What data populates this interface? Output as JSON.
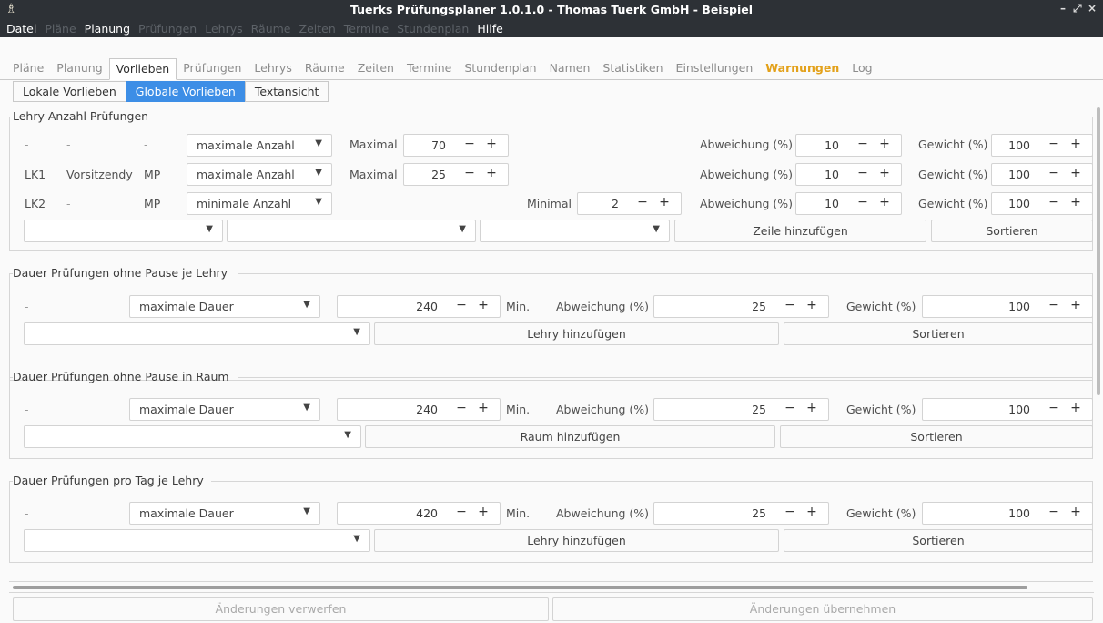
{
  "window": {
    "title": "Tuerks Prüfungsplaner 1.0.1.0 - Thomas Tuerk GmbH - Beispiel",
    "controls": [
      "–",
      "⤢",
      "×"
    ]
  },
  "menu": [
    {
      "label": "Datei",
      "enabled": true
    },
    {
      "label": "Pläne",
      "enabled": false
    },
    {
      "label": "Planung",
      "enabled": true
    },
    {
      "label": "Prüfungen",
      "enabled": false
    },
    {
      "label": "Lehrys",
      "enabled": false
    },
    {
      "label": "Räume",
      "enabled": false
    },
    {
      "label": "Zeiten",
      "enabled": false
    },
    {
      "label": "Termine",
      "enabled": false
    },
    {
      "label": "Stundenplan",
      "enabled": false
    },
    {
      "label": "Hilfe",
      "enabled": true
    }
  ],
  "tabs": [
    "Pläne",
    "Planung",
    "Vorlieben",
    "Prüfungen",
    "Lehrys",
    "Räume",
    "Zeiten",
    "Termine",
    "Stundenplan",
    "Namen",
    "Statistiken",
    "Einstellungen",
    "Warnungen",
    "Log"
  ],
  "active_tab": "Vorlieben",
  "subtabs": [
    "Lokale Vorlieben",
    "Globale Vorlieben",
    "Textansicht"
  ],
  "active_subtab": "Globale Vorlieben",
  "sections": {
    "lehry_anzahl": {
      "title": "Lehry Anzahl Prüfungen",
      "rows": [
        {
          "c1": "-",
          "c2": "-",
          "c3": "-",
          "mode": "maximale Anzahl",
          "limit_label": "Maximal",
          "limit": "70",
          "dev_label": "Abweichung (%)",
          "dev": "10",
          "weight_label": "Gewicht (%)",
          "weight": "100"
        },
        {
          "c1": "LK1",
          "c2": "Vorsitzendy",
          "c3": "MP",
          "mode": "maximale Anzahl",
          "limit_label": "Maximal",
          "limit": "25",
          "dev_label": "Abweichung (%)",
          "dev": "10",
          "weight_label": "Gewicht (%)",
          "weight": "100"
        },
        {
          "c1": "LK2",
          "c2": "-",
          "c3": "MP",
          "mode": "minimale Anzahl",
          "limit_label": "Minimal",
          "limit": "2",
          "dev_label": "Abweichung (%)",
          "dev": "10",
          "weight_label": "Gewicht (%)",
          "weight": "100"
        }
      ],
      "add_button": "Zeile hinzufügen",
      "sort_button": "Sortieren"
    },
    "dauer_lehry": {
      "title": "Dauer Prüfungen ohne Pause je Lehry",
      "row": {
        "c1": "-",
        "mode": "maximale Dauer",
        "value": "240",
        "unit": "Min.",
        "dev_label": "Abweichung (%)",
        "dev": "25",
        "weight_label": "Gewicht (%)",
        "weight": "100"
      },
      "add_button": "Lehry hinzufügen",
      "sort_button": "Sortieren"
    },
    "dauer_raum": {
      "title": "Dauer Prüfungen ohne Pause in Raum",
      "row": {
        "c1": "-",
        "mode": "maximale Dauer",
        "value": "240",
        "unit": "Min.",
        "dev_label": "Abweichung (%)",
        "dev": "25",
        "weight_label": "Gewicht (%)",
        "weight": "100"
      },
      "add_button": "Raum hinzufügen",
      "sort_button": "Sortieren"
    },
    "dauer_tag": {
      "title": "Dauer Prüfungen pro Tag je Lehry",
      "row": {
        "c1": "-",
        "mode": "maximale Dauer",
        "value": "420",
        "unit": "Min.",
        "dev_label": "Abweichung (%)",
        "dev": "25",
        "weight_label": "Gewicht (%)",
        "weight": "100"
      },
      "add_button": "Lehry hinzufügen",
      "sort_button": "Sortieren"
    }
  },
  "spin_minus": "−",
  "spin_plus": "+",
  "combo_arrow": "▼",
  "footer": {
    "discard": "Änderungen verwerfen",
    "apply": "Änderungen übernehmen"
  },
  "colors": {
    "titlebar": "#2d3136",
    "accent": "#3d8ee6",
    "warning": "#e3a11a"
  }
}
